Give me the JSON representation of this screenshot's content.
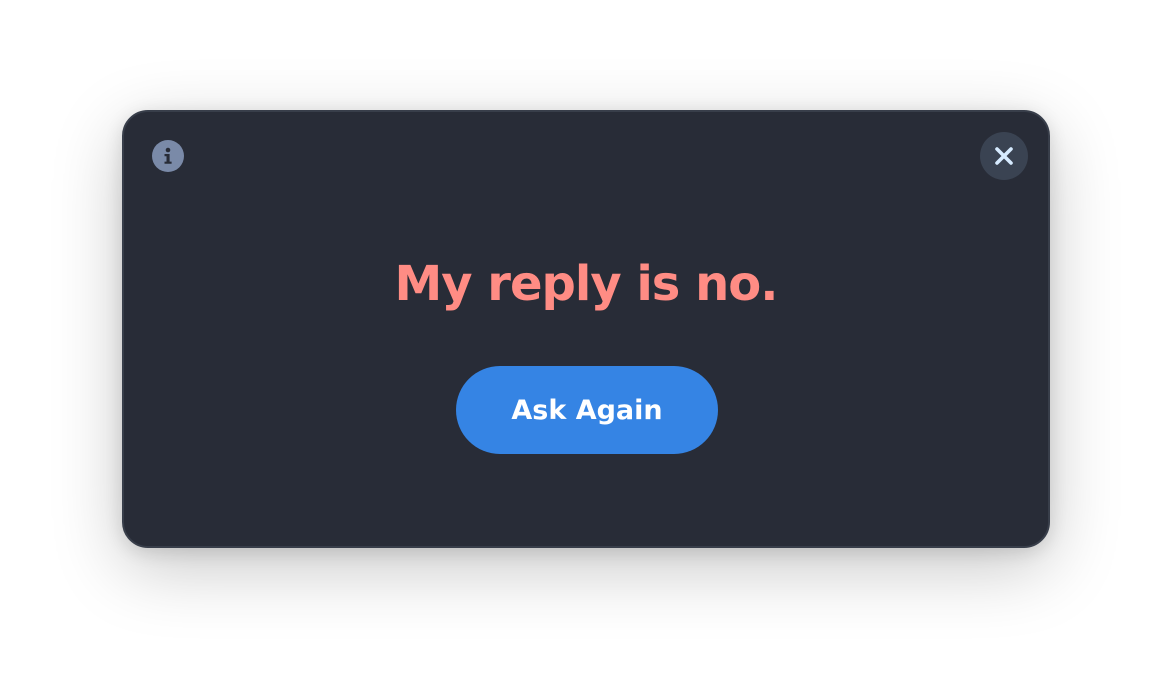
{
  "dialog": {
    "message": "My reply is no.",
    "ask_again_label": "Ask Again",
    "info_icon": "info-icon",
    "close_icon": "close-icon"
  },
  "colors": {
    "dialog_background": "#282c37",
    "message_text": "#ff8c84",
    "button_accent": "#3584e4",
    "close_glyph": "#d6ebff",
    "info_badge": "#7a8aa8"
  }
}
